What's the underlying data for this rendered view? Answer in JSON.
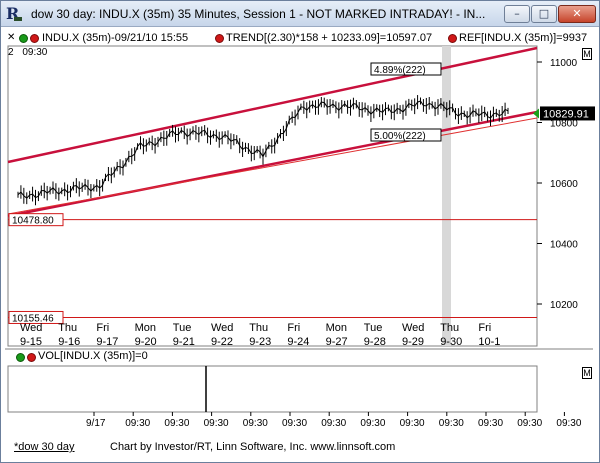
{
  "window": {
    "title": "dow 30 day: INDU.X (35m) 35 Minutes, Session 1 - NOT MARKED INTRADAY! - IN...",
    "icon": "investor-rt-logo-icon",
    "minimize_icon": "–",
    "maximize_icon": "□",
    "close_icon": "✕"
  },
  "info_line": {
    "close_glyph": "✕",
    "symbol": "INDU.X (35m)-09/21/10 15:55",
    "trend": "TREND[(2.30)*158 + 10233.09]=10597.07",
    "ref": "REF[INDU.X (35m)]=9937"
  },
  "time_row": {
    "prefix": "2",
    "time": "09:30"
  },
  "price_panel": {
    "m_button": "M",
    "current_price": "10829.91",
    "ref_lines": [
      "10478.80",
      "10155.46"
    ],
    "percent_labels": [
      "4.89%(222)",
      "5.00%(222)"
    ],
    "y_ticks": [
      "11000",
      "10800",
      "10600",
      "10400",
      "10200"
    ],
    "day_labels": [
      {
        "day": "Wed",
        "date": "9-15"
      },
      {
        "day": "Thu",
        "date": "9-16"
      },
      {
        "day": "Fri",
        "date": "9-17"
      },
      {
        "day": "Mon",
        "date": "9-20"
      },
      {
        "day": "Tue",
        "date": "9-21"
      },
      {
        "day": "Wed",
        "date": "9-22"
      },
      {
        "day": "Thu",
        "date": "9-23"
      },
      {
        "day": "Fri",
        "date": "9-24"
      },
      {
        "day": "Mon",
        "date": "9-27"
      },
      {
        "day": "Tue",
        "date": "9-28"
      },
      {
        "day": "Wed",
        "date": "9-29"
      },
      {
        "day": "Thu",
        "date": "9-30"
      },
      {
        "day": "Fri",
        "date": "10-1"
      }
    ],
    "colors": {
      "channel": "#c8103c",
      "trend": "#e03030",
      "ref_line": "#d01818",
      "bars": "#000000",
      "highlight": "#d8d8d8",
      "price_tag": "#000000",
      "price_tag_text": "#ffffff"
    }
  },
  "volume_panel": {
    "label": "VOL[INDU.X (35m)]=0",
    "m_button": "M",
    "x_labels": [
      "9/17",
      "09:30",
      "09:30",
      "09:30",
      "09:30",
      "09:30",
      "09:30",
      "09:30",
      "09:30",
      "09:30",
      "09:30",
      "09:30",
      "09:30"
    ]
  },
  "footer": {
    "tab": "*dow 30 day",
    "credit": "Chart by Investor/RT, Linn Software, Inc. www.linnsoft.com"
  },
  "chart_data": {
    "type": "line",
    "title": "",
    "xlabel": "",
    "ylabel": "",
    "x": [
      "9-15",
      "9-16",
      "9-17",
      "9-20",
      "9-21",
      "9-22",
      "9-23",
      "9-24",
      "9-27",
      "9-28",
      "9-29",
      "9-30",
      "10-1"
    ],
    "series": [
      {
        "values": [
          10555,
          10575,
          10590,
          10720,
          10770,
          10755,
          10690,
          10855,
          10855,
          10835,
          10865,
          10825,
          10829.91
        ]
      }
    ],
    "annotations": [
      "4.89%(222)",
      "5.00%(222)",
      "10478.80",
      "10155.46",
      "10829.91"
    ],
    "ylim": [
      10150,
      11050
    ],
    "yticks": [
      10200,
      10400,
      10600,
      10800,
      11000
    ],
    "grid": false,
    "legend": "none"
  }
}
